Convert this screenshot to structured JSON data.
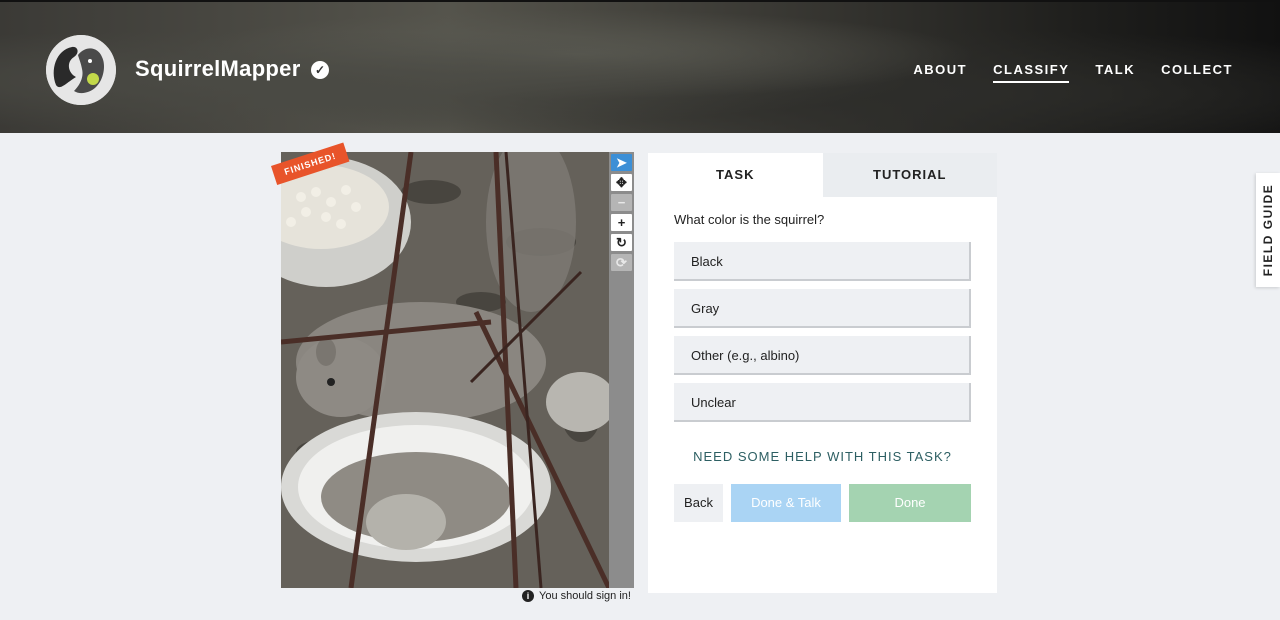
{
  "header": {
    "site_title": "SquirrelMapper",
    "verified_icon": "check-circle-icon",
    "nav": [
      "ABOUT",
      "CLASSIFY",
      "TALK",
      "COLLECT"
    ],
    "active_nav": "CLASSIFY"
  },
  "viewer": {
    "ribbon_label": "FINISHED!",
    "tools": [
      "pointer-icon",
      "pan-icon",
      "zoom-out-icon",
      "zoom-in-icon",
      "rotate-icon",
      "reset-icon"
    ],
    "active_tool": "pointer-icon",
    "signin_note": "You should sign in!"
  },
  "task_panel": {
    "tabs": [
      "TASK",
      "TUTORIAL"
    ],
    "active_tab": "TASK",
    "question": "What color is the squirrel?",
    "answers": [
      "Black",
      "Gray",
      "Other (e.g., albino)",
      "Unclear"
    ],
    "help_link": "NEED SOME HELP WITH THIS TASK?",
    "back_label": "Back",
    "done_talk_label": "Done & Talk",
    "done_label": "Done"
  },
  "field_guide": {
    "label": "FIELD GUIDE"
  },
  "colors": {
    "ribbon": "#e8542a",
    "active_tool": "#3c8fd6",
    "help_link": "#2d5f63",
    "done_talk": "#aad4f4",
    "done": "#a4d3b1",
    "page_bg": "#eef0f3"
  }
}
